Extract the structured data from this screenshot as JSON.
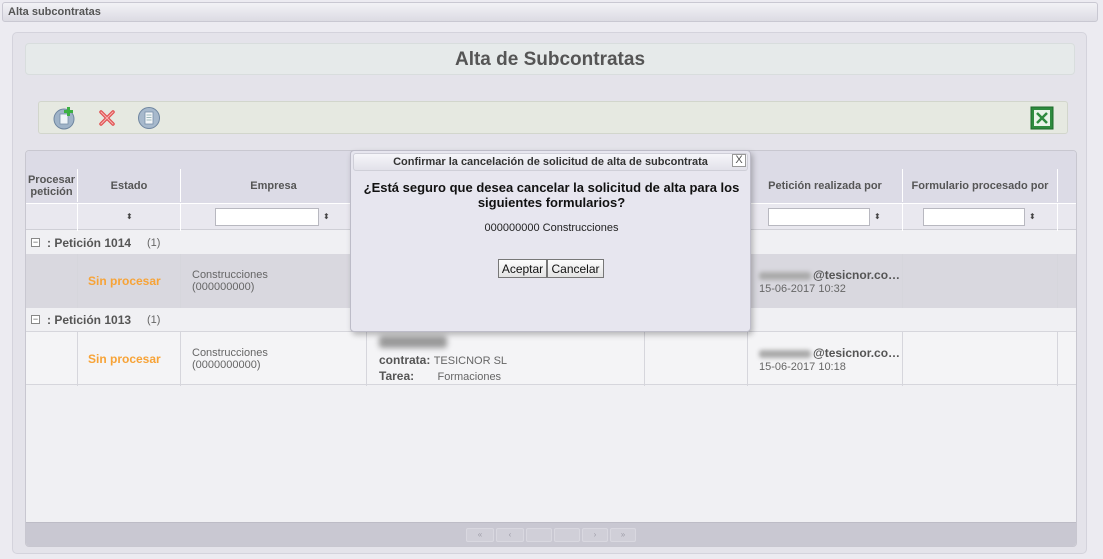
{
  "window": {
    "title": "Alta subcontratas"
  },
  "page": {
    "title": "Alta de Subcontratas"
  },
  "toolbar": {
    "add_icon": "add-sheet-icon",
    "delete_icon": "red-x-icon",
    "doc_icon": "document-icon",
    "export_icon": "excel-icon"
  },
  "grid": {
    "columns": {
      "procesar_line1": "Procesar",
      "procesar_line2": "petición",
      "estado": "Estado",
      "empresa": "Empresa",
      "peticion_realizada": "Petición realizada por",
      "formulario_procesado": "Formulario procesado por"
    },
    "sort_icon": "⬍",
    "groups": [
      {
        "title": ": Petición 1014",
        "count": "(1)",
        "row": {
          "estado": "Sin procesar",
          "empresa_line1": "Construcciones",
          "empresa_line2": "(000000000)",
          "user_domain": "@tesicnor.co…",
          "date": "15-06-2017 10:32"
        }
      },
      {
        "title": ": Petición 1013",
        "count": "(1)",
        "row": {
          "estado": "Sin procesar",
          "empresa_line1": "Construcciones",
          "empresa_line2": "(0000000000)",
          "contrata_label": "contrata:",
          "contrata_value": "TESICNOR SL",
          "tarea_label": "Tarea:",
          "tarea_value": "Formaciones",
          "user_domain": "@tesicnor.co…",
          "date": "15-06-2017 10:18"
        }
      }
    ],
    "pager": [
      "«",
      "‹",
      "",
      "",
      "›",
      "»"
    ]
  },
  "dialog": {
    "title": "Confirmar la cancelación de solicitud de alta de subcontrata",
    "close": "X",
    "question": "¿Está seguro que desea cancelar la solicitud de alta para los siguientes formularios?",
    "item": "000000000 Construcciones",
    "accept": "Aceptar",
    "cancel": "Cancelar"
  }
}
